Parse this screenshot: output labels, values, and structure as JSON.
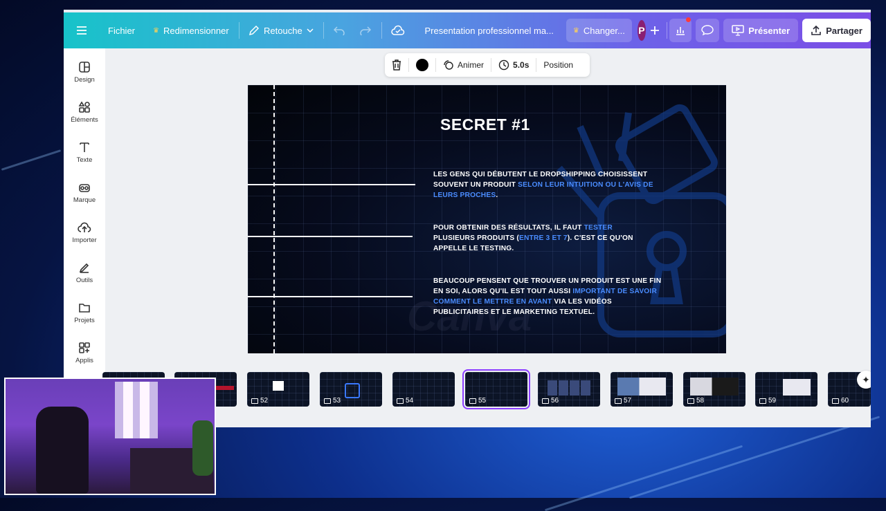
{
  "topbar": {
    "menu_label": "Fichier",
    "resize_label": "Redimensionner",
    "retouch_label": "Retouche",
    "doc_title": "Presentation professionnel ma...",
    "upgrade_label": "Changer...",
    "avatar_initial": "P",
    "present_label": "Présenter",
    "share_label": "Partager"
  },
  "sidebar": {
    "items": [
      {
        "label": "Design",
        "icon": "layout-icon"
      },
      {
        "label": "Éléments",
        "icon": "shapes-icon"
      },
      {
        "label": "Texte",
        "icon": "text-icon"
      },
      {
        "label": "Marque",
        "icon": "brand-icon"
      },
      {
        "label": "Importer",
        "icon": "upload-cloud-icon"
      },
      {
        "label": "Outils",
        "icon": "draw-tool-icon"
      },
      {
        "label": "Projets",
        "icon": "folder-icon"
      },
      {
        "label": "Applis",
        "icon": "apps-icon"
      }
    ]
  },
  "context_toolbar": {
    "animate_label": "Animer",
    "duration_label": "5.0s",
    "position_label": "Position"
  },
  "slide": {
    "title": "SECRET #1",
    "p1_a": "LES GENS QUI DÉBUTENT LE DROPSHIPPING CHOISISSENT SOUVENT UN PRODUIT ",
    "p1_hl": "SELON LEUR INTUITION OU L'AVIS DE LEURS PROCHES",
    "p1_b": ".",
    "p2_a": "POUR OBTENIR DES RÉSULTATS, IL FAUT ",
    "p2_hl1": "TESTER",
    "p2_b": " PLUSIEURS PRODUITS (",
    "p2_hl2": "ENTRE 3 ET 7",
    "p2_c": "). C'EST CE QU'ON APPELLE LE TESTING.",
    "p3_a": "BEAUCOUP PENSENT QUE TROUVER UN PRODUIT EST UNE FIN EN SOI, ALORS QU'IL EST TOUT AUSSI ",
    "p3_hl": "IMPORTANT DE SAVOIR COMMENT LE METTRE EN AVANT",
    "p3_b": " VIA LES VIDÉOS PUBLICITAIRES ET LE MARKETING TEXTUEL."
  },
  "thumbnails": [
    {
      "num": "52"
    },
    {
      "num": "53"
    },
    {
      "num": "54"
    },
    {
      "num": "55",
      "active": true
    },
    {
      "num": "56"
    },
    {
      "num": "57"
    },
    {
      "num": "58"
    },
    {
      "num": "59"
    },
    {
      "num": "60"
    }
  ],
  "colors": {
    "accent": "#8b3dff",
    "highlight": "#4a8cff",
    "avatar": "#8a1f72"
  }
}
